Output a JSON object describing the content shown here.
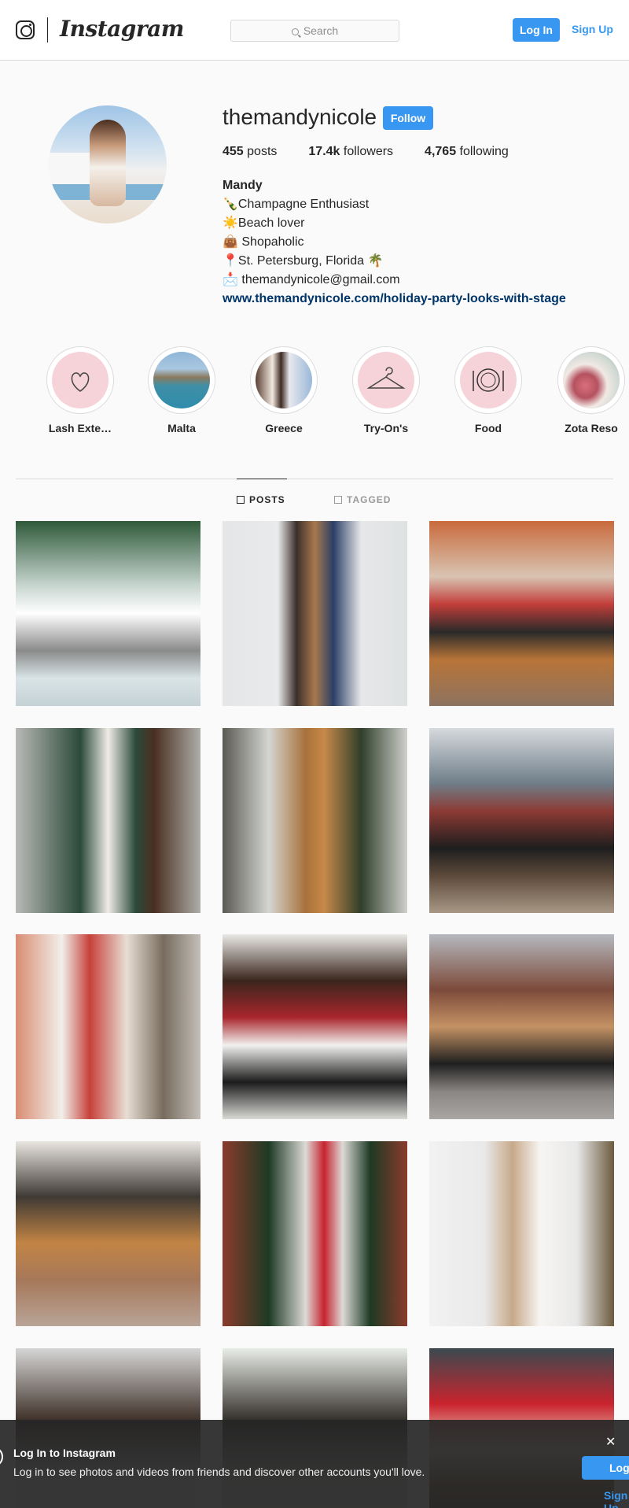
{
  "header": {
    "logo_word": "Instagram",
    "search_placeholder": "Search",
    "login_label": "Log In",
    "signup_label": "Sign Up"
  },
  "profile": {
    "username": "themandynicole",
    "follow_label": "Follow",
    "posts_count": "455",
    "posts_label": "posts",
    "followers_count": "17.4k",
    "followers_label": "followers",
    "following_count": "4,765",
    "following_label": "following",
    "name": "Mandy",
    "bio_lines": [
      "🍾Champagne Enthusiast",
      "☀️Beach lover",
      "👜 Shopaholic",
      "📍St. Petersburg, Florida 🌴",
      "📩 themandynicole@gmail.com"
    ],
    "website": "www.themandynicole.com/holiday-party-looks-with-stage"
  },
  "highlights": [
    {
      "label": "Lash Exte…",
      "icon": "heart-icon"
    },
    {
      "label": "Malta",
      "icon": "photo-thumbnail"
    },
    {
      "label": "Greece",
      "icon": "photo-thumbnail"
    },
    {
      "label": "Try-On's",
      "icon": "hanger-icon"
    },
    {
      "label": "Food",
      "icon": "plate-icon"
    },
    {
      "label": "Zota Reso",
      "icon": "photo-thumbnail"
    }
  ],
  "tabs": {
    "posts_label": "POSTS",
    "tagged_label": "TAGGED"
  },
  "banner": {
    "title": "Log In to Instagram",
    "text": "Log in to see photos and videos from friends and discover other accounts you'll love.",
    "close": "✕",
    "login_label": "Log In",
    "signup_label": "Sign Up"
  },
  "colors": {
    "accent": "#3897f0",
    "link": "#003569",
    "highlight_bg": "#f6d3d8"
  }
}
